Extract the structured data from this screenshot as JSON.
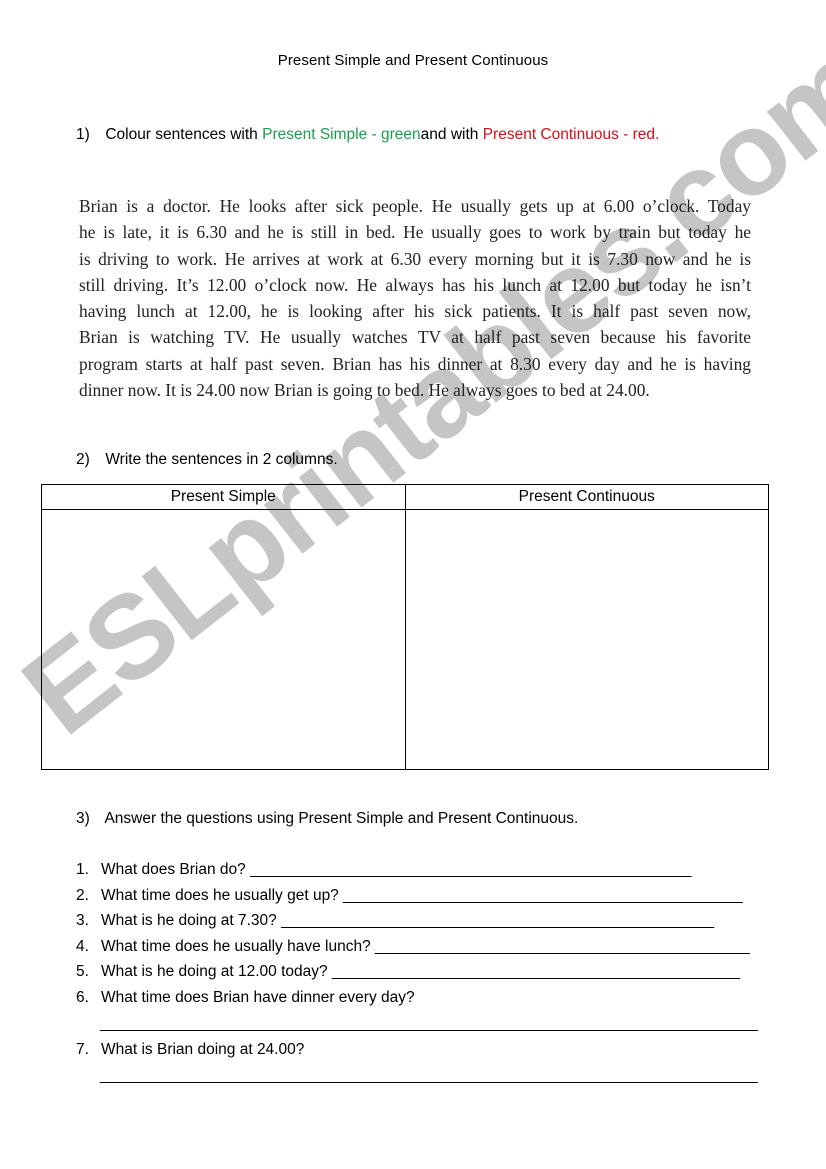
{
  "title": "Present Simple and Present Continuous",
  "colors": {
    "present_simple": "#1e9b4f",
    "present_continuous": "#d0121b",
    "watermark": "#969696"
  },
  "task1": {
    "number": "1)",
    "text_before": "Colour sentences with ",
    "green_part": "Present Simple - green",
    "text_middle": "and with ",
    "red_part": "Present Continuous - red."
  },
  "story": {
    "lines": [
      "Brian is a doctor. He looks after sick people. He usually gets up at 6.00 o’clock. Today",
      "he is late, it is 6.30 and he is still in bed. He usually goes to work by train but today he",
      "is driving to work. He arrives at work at 6.30 every morning but it is 7.30 now and he is",
      "still driving. It’s 12.00 o’clock now. He always has his lunch at 12.00 but today he isn’t",
      "having lunch at 12.00, he is looking after his sick patients. It is half past seven now,",
      "Brian is watching TV. He usually watches TV at half past seven because his favorite",
      "program starts at half past seven. Brian has his dinner at 8.30 every day and he is having",
      "dinner now. It is 24.00 now Brian is going to bed. He always goes to bed at 24.00."
    ]
  },
  "task2": {
    "number": "2)",
    "text": "Write the sentences in 2 columns.",
    "table": {
      "headers": [
        "Present Simple",
        "Present Continuous"
      ],
      "cells": [
        "",
        ""
      ]
    }
  },
  "task3": {
    "number": "3)",
    "text": "Answer the questions using Present Simple and Present Continuous.",
    "questions": [
      {
        "n": "1.",
        "text": "What does Brian do?",
        "blank": "_____________________________________________________"
      },
      {
        "n": "2.",
        "text": "What time does he usually get up?",
        "blank": "________________________________________________"
      },
      {
        "n": "3.",
        "text": "What is he doing at 7.30?",
        "blank": "____________________________________________________"
      },
      {
        "n": "4.",
        "text": "What time does he usually have lunch?",
        "blank": "_____________________________________________"
      },
      {
        "n": "5.",
        "text": "What is he doing at 12.00 today?",
        "blank": "_________________________________________________"
      },
      {
        "n": "6.",
        "text": "What time does Brian have dinner every day?",
        "blank": ""
      },
      {
        "n": "7.",
        "text": "What is Brian doing at 24.00?",
        "blank": ""
      }
    ],
    "answer_line": "_______________________________________________________________________________"
  },
  "watermark": "ESLprintables.com"
}
